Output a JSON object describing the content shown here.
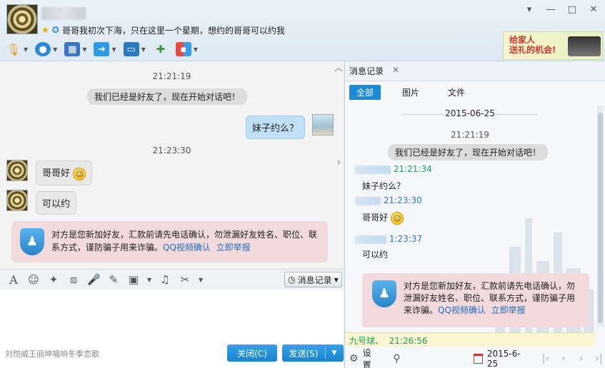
{
  "header": {
    "signature": "哥哥我初次下海，只在这里一个星期，想约的哥哥可以约我",
    "ad_text_line1": "给家人",
    "ad_text_line2": "送礼的机会!",
    "window_controls": [
      "▾",
      "—",
      "□",
      "✕"
    ]
  },
  "toolbar_icons": [
    "microphone-icon",
    "webcam-icon",
    "screen-share-icon",
    "file-transfer-icon",
    "remote-desktop-icon",
    "add-chat-icon",
    "apps-icon"
  ],
  "chat": {
    "time1": "21:21:19",
    "system1": "我们已经是好友了，现在开始对话吧！",
    "out1": "妹子约么？",
    "time2": "21:23:30",
    "in1": "哥哥好",
    "in2": "可以约",
    "warning_text": "对方是您新加好友，汇款前请先电话确认，勿泄漏好友姓名、职位、联系方式，谨防骗子用来诈骗。",
    "warning_link1": "QQ视频确认",
    "warning_link2": "立即举报"
  },
  "input_toolbar": {
    "history_label": "消息记录"
  },
  "footer": {
    "ticker": "刘恺威王丽坤唱响冬季恋歌",
    "close_label": "关闭(C)",
    "send_label": "发送(S)"
  },
  "history": {
    "tab_label": "消息记录",
    "filters": [
      "全部",
      "图片",
      "文件"
    ],
    "date": "2015-06-25",
    "time1": "21:21:19",
    "system1": "我们已经是好友了，现在开始对话吧！",
    "r1_time": "21:21:34",
    "r1_msg": "妹子约么？",
    "r2_time": "21:23:30",
    "r2_msg": "哥哥好",
    "r3_time": "1:23:37",
    "r3_msg": "可以约",
    "warning_text": "对方是您新加好友，汇款前请先电话确认，勿泄漏好友姓名、职位、联系方式，谨防骗子用来诈骗。",
    "warning_link1": "QQ视频确认",
    "warning_link2": "立即举报",
    "last_name": "九号球、",
    "last_time": "21:26:56",
    "settings_label": "设置",
    "footer_date": "2015-6-25"
  },
  "colors": {
    "accent": "#1b8ad8",
    "green_time": "#17a35a",
    "blue_time": "#2a7ad3",
    "warning_bg": "#f1d9dc"
  }
}
